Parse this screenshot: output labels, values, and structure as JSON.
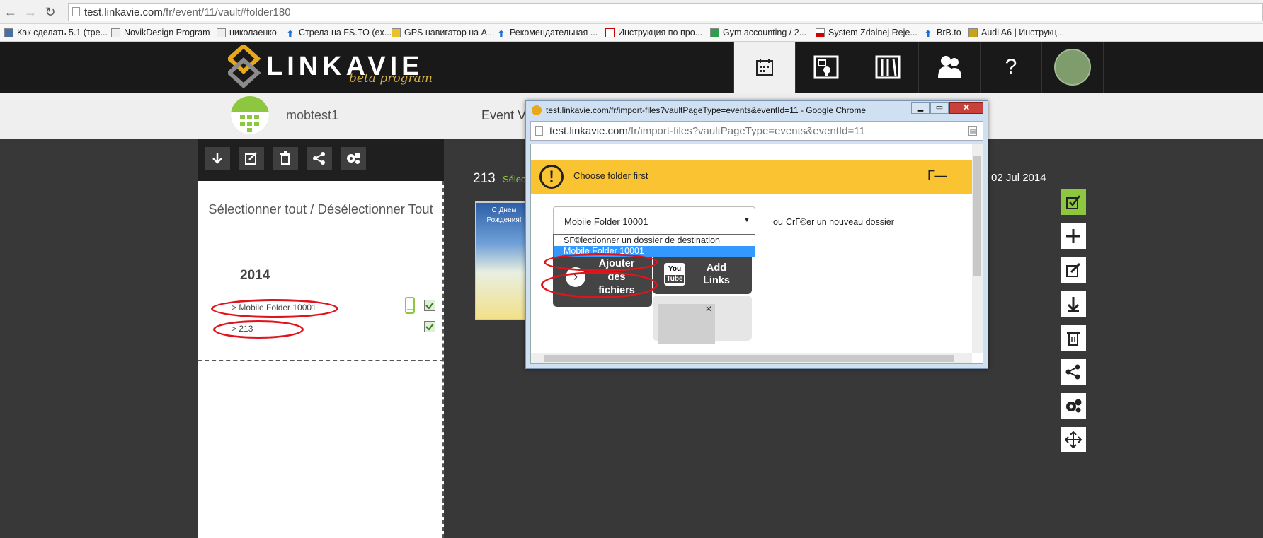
{
  "browser": {
    "url_host": "test.linkavie.com",
    "url_path": "/fr/event/11/vault#folder180"
  },
  "bookmarks": [
    "Как сделать 5.1 (тре...",
    "NovikDesign Program",
    "николаенко",
    "Стрела на FS.TO (ex...",
    "GPS навигатор на A...",
    "Рекомендательная ...",
    "Инструкция по про...",
    "Gym accounting / 2...",
    "System Zdalnej Reje...",
    "BrB.to",
    "Audi A6 | Инструкц..."
  ],
  "logo": {
    "text": "LINKAVIE",
    "sub": "beta program"
  },
  "nav": {
    "help": "?"
  },
  "subheader": {
    "username": "mobtest1",
    "event_tab": "Event Va"
  },
  "left_panel": {
    "select_all": "Sélectionner tout / Désélectionner Tout",
    "year": "2014",
    "folders": [
      "> Mobile Folder 10001",
      "> 213"
    ]
  },
  "main": {
    "folder_title": "213",
    "select_link": "Sélec",
    "date": "02 Jul 2014",
    "thumb_caption": "С Днем Рождения!"
  },
  "popup": {
    "title": "test.linkavie.com/fr/import-files?vaultPageType=events&eventId=11 - Google Chrome",
    "url_host": "test.linkavie.com",
    "url_path": "/fr/import-files?vaultPageType=events&eventId=11",
    "warning": "Choose folder first",
    "warning_right": "Г—",
    "select_value": "Mobile Folder 10001",
    "options": [
      "SГ©lectionner un dossier de destination",
      "Mobile Folder 10001"
    ],
    "create_prefix": "ou",
    "create_link": "CrГ©er un nouveau dossier",
    "add_files": "Ajouter des fichiers",
    "add_links": "Add Links",
    "youtube_top": "You",
    "youtube_bottom": "Tube",
    "close_x": "✕"
  },
  "colors": {
    "accent": "#8dc63f",
    "warning": "#f9c332",
    "header": "#191919",
    "select_highlight": "#3399ff",
    "annotation": "#e0141c"
  }
}
